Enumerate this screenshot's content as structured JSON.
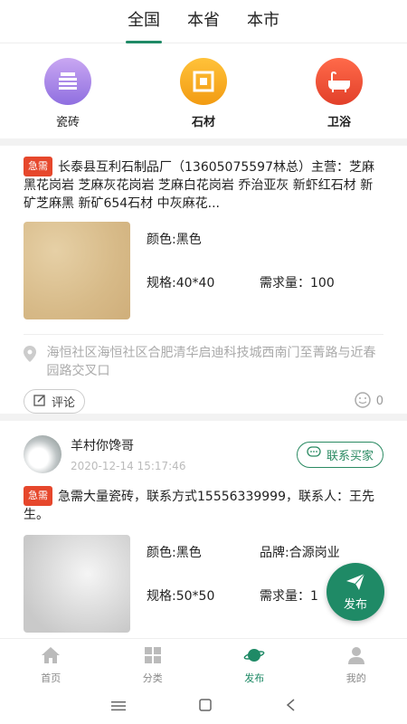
{
  "tabs": [
    "全国",
    "本省",
    "本市"
  ],
  "categories": [
    {
      "label": "瓷砖"
    },
    {
      "label": "石材"
    },
    {
      "label": "卫浴"
    }
  ],
  "posts": [
    {
      "badge": "急需",
      "description": "长泰县互利石制品厂（13605075597林总）主营：芝麻黑花岗岩 芝麻灰花岗岩 芝麻白花岗岩 乔治亚灰 新虾红石材 新矿芝麻黑 新矿654石材 中灰麻花...",
      "color": "颜色:黑色",
      "spec": "规格:40*40",
      "demand": "需求量：100",
      "location": "海恒社区海恒社区合肥清华启迪科技城西南门至菁路与近春园路交叉口",
      "comment_label": "评论",
      "likes": "0"
    },
    {
      "user_name": "羊村你馋哥",
      "time": "2020-12-14 15:17:46",
      "contact_label": "联系买家",
      "badge": "急需",
      "description": "急需大量瓷砖，联系方式15556339999，联系人：王先生。",
      "color": "颜色:黑色",
      "brand": "品牌:合源岗业",
      "spec": "规格:50*50",
      "demand": "需求量：1"
    }
  ],
  "fab": {
    "label": "发布"
  },
  "bottom_nav": [
    {
      "label": "首页"
    },
    {
      "label": "分类"
    },
    {
      "label": "发布"
    },
    {
      "label": "我的"
    }
  ],
  "colors": {
    "accent": "#1f8a66",
    "urgent": "#e6472c"
  }
}
